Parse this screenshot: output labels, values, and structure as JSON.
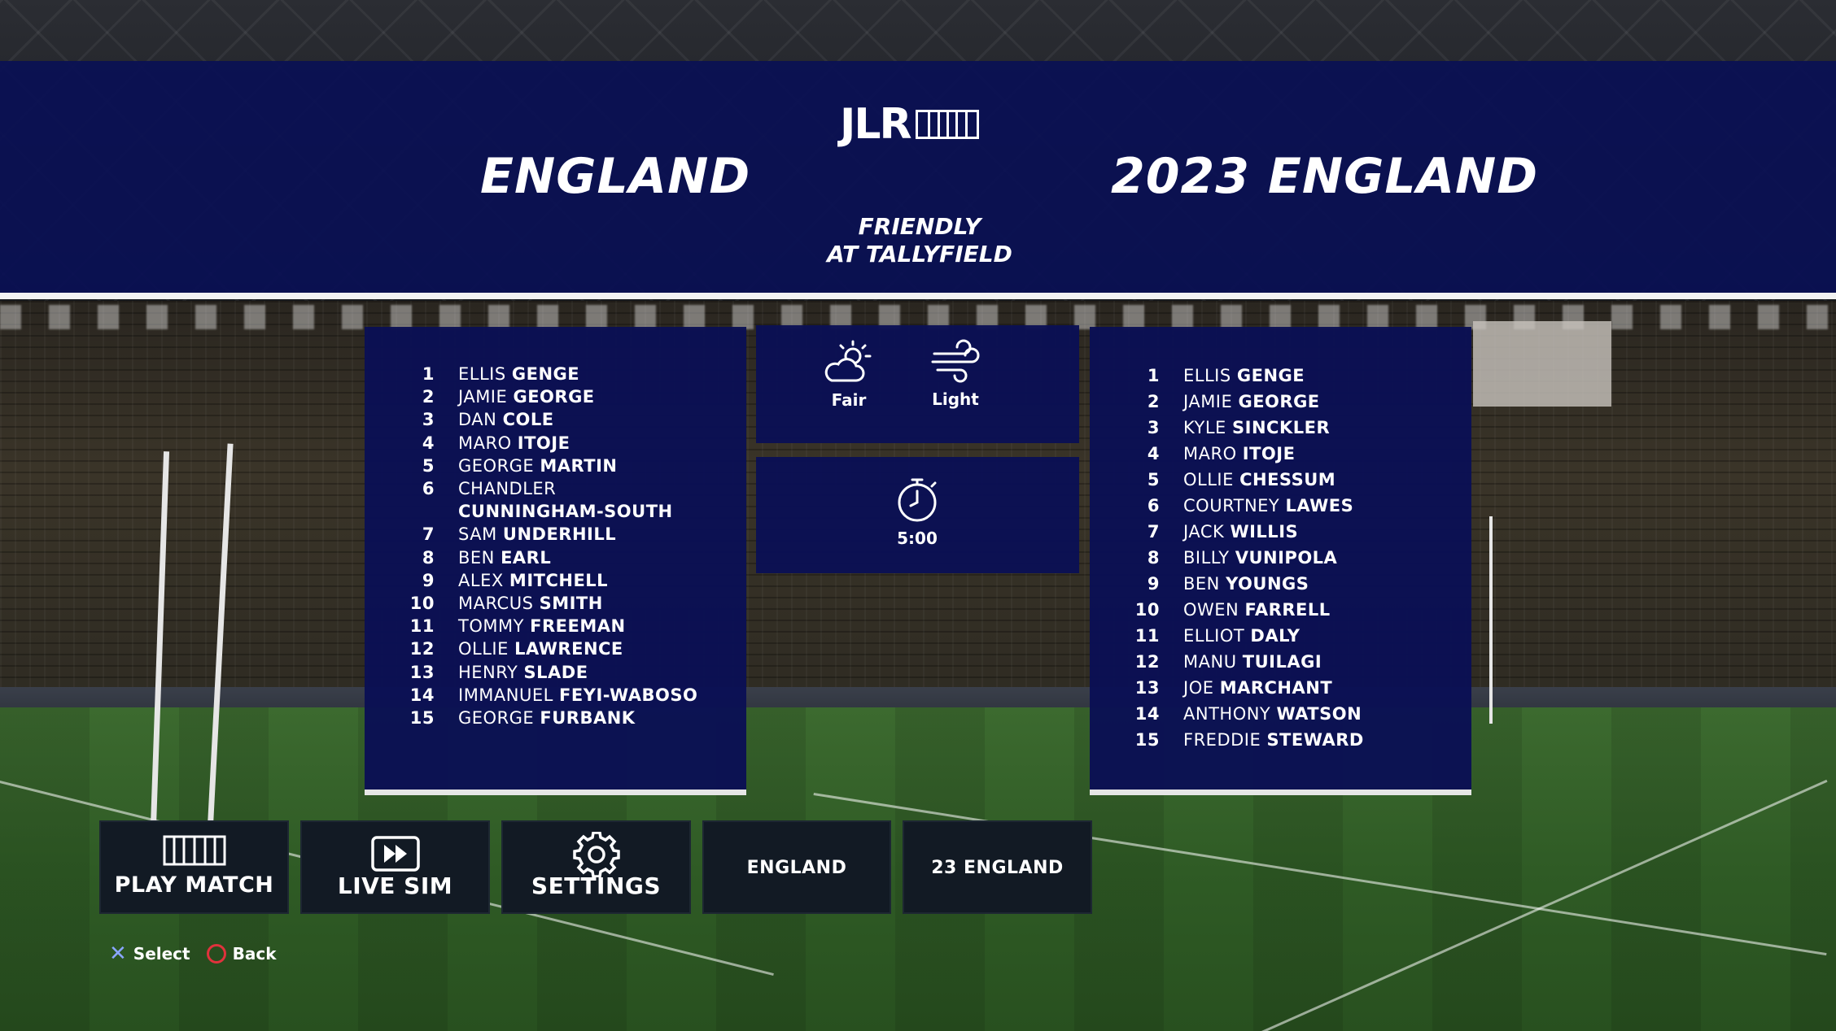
{
  "header": {
    "logo": "JLR",
    "home_team": "ENGLAND",
    "away_team": "2023 ENGLAND",
    "match_type_line1": "FRIENDLY",
    "match_type_line2": "AT TALLYFIELD"
  },
  "home_lineup": [
    {
      "num": "1",
      "first": "ELLIS",
      "last": "GENGE"
    },
    {
      "num": "2",
      "first": "JAMIE",
      "last": "GEORGE"
    },
    {
      "num": "3",
      "first": "DAN",
      "last": "COLE"
    },
    {
      "num": "4",
      "first": "MARO",
      "last": "ITOJE"
    },
    {
      "num": "5",
      "first": "GEORGE",
      "last": "MARTIN"
    },
    {
      "num": "6",
      "first": "CHANDLER",
      "last": "CUNNINGHAM-SOUTH"
    },
    {
      "num": "7",
      "first": "SAM",
      "last": "UNDERHILL"
    },
    {
      "num": "8",
      "first": "BEN",
      "last": "EARL"
    },
    {
      "num": "9",
      "first": "ALEX",
      "last": "MITCHELL"
    },
    {
      "num": "10",
      "first": "MARCUS",
      "last": "SMITH"
    },
    {
      "num": "11",
      "first": "TOMMY",
      "last": "FREEMAN"
    },
    {
      "num": "12",
      "first": "OLLIE",
      "last": "LAWRENCE"
    },
    {
      "num": "13",
      "first": "HENRY",
      "last": "SLADE"
    },
    {
      "num": "14",
      "first": "IMMANUEL",
      "last": "FEYI-WABOSO"
    },
    {
      "num": "15",
      "first": "GEORGE",
      "last": "FURBANK"
    }
  ],
  "away_lineup": [
    {
      "num": "1",
      "first": "ELLIS",
      "last": "GENGE"
    },
    {
      "num": "2",
      "first": "JAMIE",
      "last": "GEORGE"
    },
    {
      "num": "3",
      "first": "KYLE",
      "last": "SINCKLER"
    },
    {
      "num": "4",
      "first": "MARO",
      "last": "ITOJE"
    },
    {
      "num": "5",
      "first": "OLLIE",
      "last": "CHESSUM"
    },
    {
      "num": "6",
      "first": "COURTNEY",
      "last": "LAWES"
    },
    {
      "num": "7",
      "first": "JACK",
      "last": "WILLIS"
    },
    {
      "num": "8",
      "first": "BILLY",
      "last": "VUNIPOLA"
    },
    {
      "num": "9",
      "first": "BEN",
      "last": "YOUNGS"
    },
    {
      "num": "10",
      "first": "OWEN",
      "last": "FARRELL"
    },
    {
      "num": "11",
      "first": "ELLIOT",
      "last": "DALY"
    },
    {
      "num": "12",
      "first": "MANU",
      "last": "TUILAGI"
    },
    {
      "num": "13",
      "first": "JOE",
      "last": "MARCHANT"
    },
    {
      "num": "14",
      "first": "ANTHONY",
      "last": "WATSON"
    },
    {
      "num": "15",
      "first": "FREDDIE",
      "last": "STEWARD"
    }
  ],
  "conditions": {
    "weather_label": "Fair",
    "weather_icon": "partly-cloudy-icon",
    "wind_label": "Light",
    "wind_icon": "wind-icon",
    "match_length": "5:00",
    "timer_icon": "stopwatch-icon"
  },
  "buttons": {
    "play_match": "PLAY MATCH",
    "live_sim": "LIVE SIM",
    "settings": "SETTINGS",
    "home_team": "ENGLAND",
    "away_team": "23 ENGLAND"
  },
  "hints": {
    "select": "Select",
    "back": "Back"
  },
  "colors": {
    "panel_navy": "#0a1054",
    "button_dark": "#121a24",
    "text": "#ffffff",
    "back_hint_red": "#e0323c",
    "select_hint_blue": "#8aa6ff"
  }
}
